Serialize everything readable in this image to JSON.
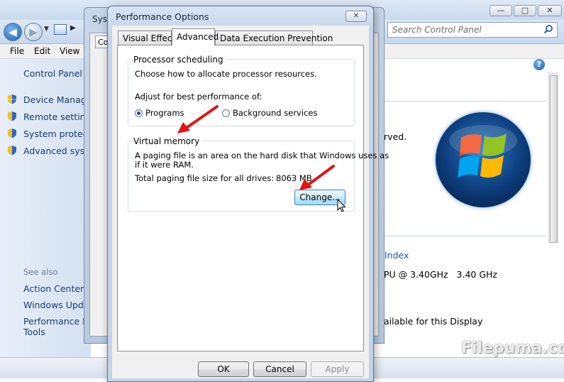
{
  "control_panel": {
    "search_placeholder": "Search Control Panel",
    "menu": [
      "File",
      "Edit",
      "View"
    ],
    "sidebar_home": "Control Panel H",
    "sidebar_tasks": [
      "Device Manager",
      "Remote settings",
      "System protection",
      "Advanced system"
    ],
    "see_also_label": "See also",
    "see_also": [
      "Action Center",
      "Windows Updat",
      "Performance Info",
      "Tools"
    ],
    "main_fragments": {
      "reserved": "rved.",
      "index": "Index",
      "cpu": "PU @ 3.40GHz   3.40 GHz",
      "display": "ailable for this Display"
    },
    "window_buttons": {
      "minimize": "—",
      "maximize": "□",
      "close": "✕"
    },
    "help_glyph": "?"
  },
  "system_properties": {
    "title": "Syst",
    "tab_partial": "Co"
  },
  "performance_options": {
    "title": "Performance Options",
    "close_glyph": "✕",
    "tabs": [
      "Visual Effects",
      "Advanced",
      "Data Execution Prevention"
    ],
    "active_tab": "Advanced",
    "processor_scheduling": {
      "label": "Processor scheduling",
      "description": "Choose how to allocate processor resources.",
      "adjust_label": "Adjust for best performance of:",
      "options": [
        "Programs",
        "Background services"
      ],
      "selected": "Programs"
    },
    "virtual_memory": {
      "label": "Virtual memory",
      "description_line1": "A paging file is an area on the hard disk that Windows uses as",
      "description_line2": "if it were RAM.",
      "total_label": "Total paging file size for all drives:",
      "total_value": "8063 MB",
      "change_button": "Change..."
    },
    "buttons": {
      "ok": "OK",
      "cancel": "Cancel",
      "apply": "Apply"
    }
  },
  "watermark": "Filepuma.com",
  "colors": {
    "annotation_arrow": "#e21414",
    "link_blue": "#1a3a6b"
  }
}
